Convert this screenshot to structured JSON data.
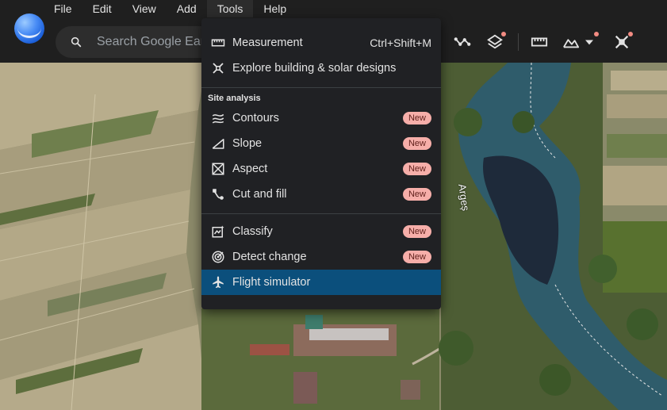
{
  "menubar": {
    "items": [
      "File",
      "Edit",
      "View",
      "Add",
      "Tools",
      "Help"
    ]
  },
  "search": {
    "placeholder": "Search Google Earth"
  },
  "toolbar_icons": [
    "path-icon",
    "layers-icon",
    "ruler-icon",
    "terrain-icon",
    "chevron-down-icon",
    "flight-tools-icon"
  ],
  "map": {
    "river_label": "Argeș"
  },
  "tools_menu": {
    "measurement": {
      "label": "Measurement",
      "shortcut": "Ctrl+Shift+M"
    },
    "explore": {
      "label": "Explore building & solar designs"
    },
    "section_title": "Site analysis",
    "analysis_items": [
      {
        "label": "Contours",
        "badge": "New",
        "icon": "contours-icon"
      },
      {
        "label": "Slope",
        "badge": "New",
        "icon": "slope-icon"
      },
      {
        "label": "Aspect",
        "badge": "New",
        "icon": "aspect-icon"
      },
      {
        "label": "Cut and fill",
        "badge": "New",
        "icon": "cut-fill-icon"
      }
    ],
    "classify": {
      "label": "Classify",
      "badge": "New"
    },
    "detect_change": {
      "label": "Detect change",
      "badge": "New"
    },
    "flight_simulator": {
      "label": "Flight simulator"
    }
  },
  "colors": {
    "menu_bg": "#202124",
    "highlight": "#0b4f7c",
    "badge_bg": "#f6aea9",
    "badge_text": "#5f1f1a",
    "notification_dot": "#f28b82"
  }
}
